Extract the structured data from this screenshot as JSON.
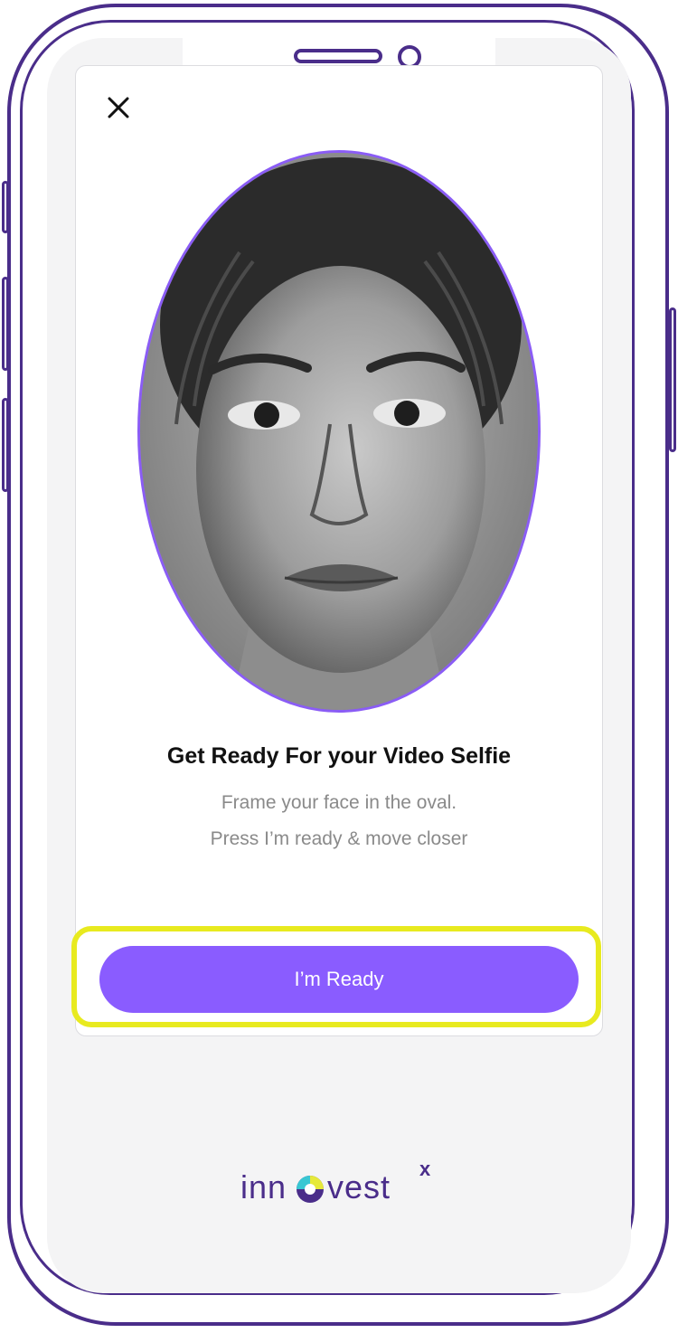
{
  "screen": {
    "title": "Get Ready For your Video Selfie",
    "instruction_line1": "Frame your face in the oval.",
    "instruction_line2": "Press I’m ready & move closer",
    "ready_button_label": "I’m Ready"
  },
  "icons": {
    "close": "close-icon",
    "face": "face-photo"
  },
  "brand": {
    "name_left": "inn",
    "name_right": "vest",
    "superscript": "x"
  },
  "colors": {
    "frame": "#4a2d8a",
    "accent": "#8a5cff",
    "highlight": "#e8ea1f",
    "brand_logo_o_yellow": "#e6e93a",
    "brand_logo_o_cyan": "#39c7d3"
  }
}
